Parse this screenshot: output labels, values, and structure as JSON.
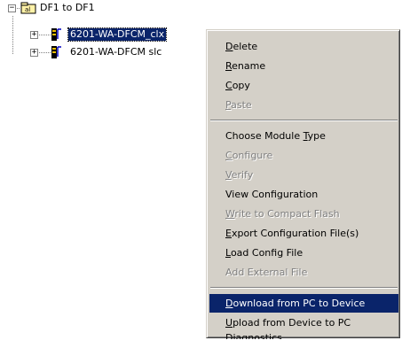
{
  "tree": {
    "root": {
      "label": "DF1 to DF1",
      "expander": "−"
    },
    "children": [
      {
        "label": "6201-WA-DFCM_clx",
        "expander": "+",
        "selected": true
      },
      {
        "label": "6201-WA-DFCM slc",
        "expander": "+",
        "selected": false
      }
    ]
  },
  "context_menu": {
    "items": [
      {
        "pre": "",
        "key": "D",
        "post": "elete",
        "state": "enabled"
      },
      {
        "pre": "",
        "key": "R",
        "post": "ename",
        "state": "enabled"
      },
      {
        "pre": "",
        "key": "C",
        "post": "opy",
        "state": "enabled"
      },
      {
        "pre": "",
        "key": "P",
        "post": "aste",
        "state": "disabled"
      },
      {
        "pre": "Choose Module ",
        "key": "T",
        "post": "ype",
        "state": "enabled"
      },
      {
        "pre": "",
        "key": "C",
        "post": "onfigure",
        "state": "disabled"
      },
      {
        "pre": "",
        "key": "V",
        "post": "erify",
        "state": "disabled"
      },
      {
        "pre": "View Configuration",
        "key": "",
        "post": "",
        "state": "enabled"
      },
      {
        "pre": "",
        "key": "W",
        "post": "rite to Compact Flash",
        "state": "disabled"
      },
      {
        "pre": "",
        "key": "E",
        "post": "xport Configuration File(s)",
        "state": "enabled"
      },
      {
        "pre": "",
        "key": "L",
        "post": "oad Config File",
        "state": "enabled"
      },
      {
        "pre": "Add External File",
        "key": "",
        "post": "",
        "state": "disabled"
      },
      {
        "pre": "",
        "key": "D",
        "post": "ownload from PC to Device",
        "state": "highlighted"
      },
      {
        "pre": "",
        "key": "U",
        "post": "pload from Device to PC",
        "state": "enabled"
      },
      {
        "pre": "Dia",
        "key": "g",
        "post": "nostics",
        "state": "enabled"
      }
    ]
  }
}
